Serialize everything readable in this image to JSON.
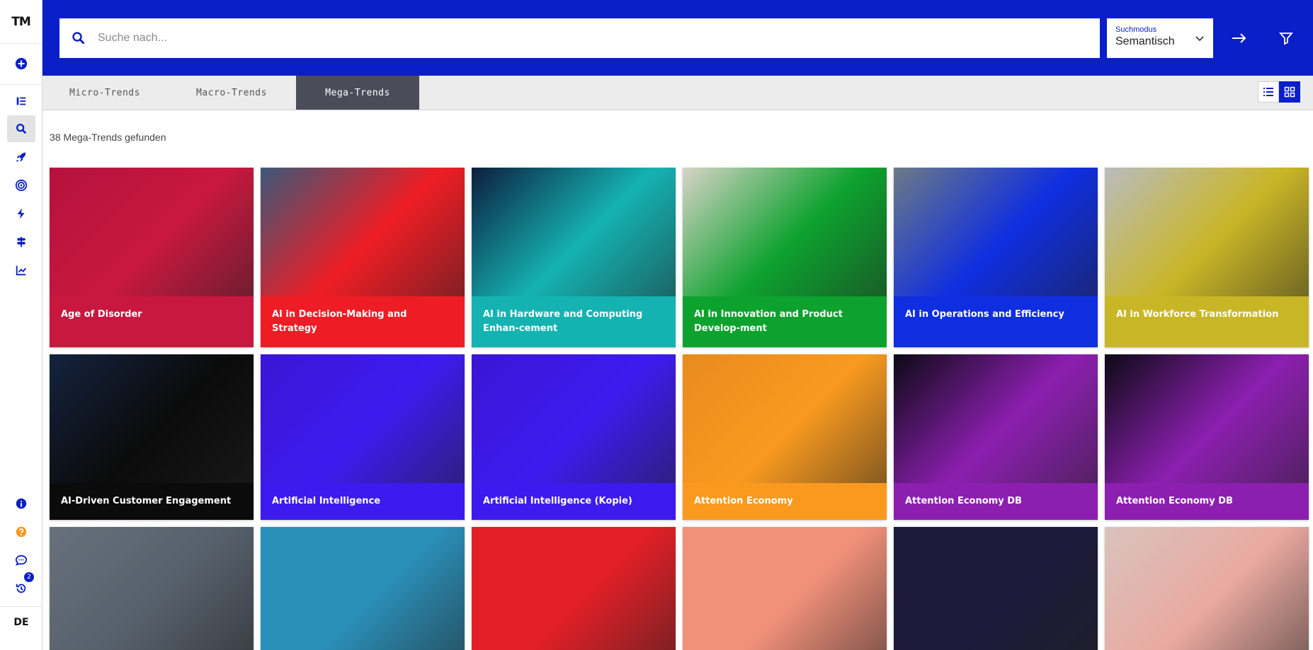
{
  "sidebar": {
    "logo": "TM",
    "language": "DE",
    "history_badge": "2"
  },
  "search": {
    "placeholder": "Suche nach...",
    "value": "",
    "mode_label": "Suchmodus",
    "mode_value": "Semantisch"
  },
  "tabs": [
    {
      "label": "Micro-Trends"
    },
    {
      "label": "Macro-Trends"
    },
    {
      "label": "Mega-Trends"
    }
  ],
  "results": {
    "count_text": "38 Mega-Trends gefunden"
  },
  "cards": [
    {
      "title": "Age of Disorder",
      "color": "#c8183f",
      "art": "#b5123d"
    },
    {
      "title": "AI in Decision-Making and Strategy",
      "color": "#ee1d25",
      "art": "#3b5878"
    },
    {
      "title": "AI in Hardware and Computing Enhan-cement",
      "color": "#15b2b2",
      "art": "#0c1d3e"
    },
    {
      "title": "AI in Innovation and Product Develop-ment",
      "color": "#0da22e",
      "art": "#d9d3c8"
    },
    {
      "title": "AI in Operations and Efficiency",
      "color": "#0f2ee0",
      "art": "#6c7a86"
    },
    {
      "title": "AI in Workforce Transformation",
      "color": "#c9b626",
      "art": "#b9bcbf"
    },
    {
      "title": "AI-Driven Customer Engagement",
      "color": "#0b0b0b",
      "art": "#14233e"
    },
    {
      "title": "Artificial Intelligence",
      "color": "#3d1bef",
      "art": "#3a16d3"
    },
    {
      "title": "Artificial Intelligence (Kopie)",
      "color": "#3d1bef",
      "art": "#3a16d3"
    },
    {
      "title": "Attention Economy",
      "color": "#f99a1f",
      "art": "#e98a1f"
    },
    {
      "title": "Attention Economy DB",
      "color": "#8c1fb0",
      "art": "#0c0a14"
    },
    {
      "title": "Attention Economy DB",
      "color": "#8c1fb0",
      "art": "#0c0a14"
    },
    {
      "title": "",
      "color": "#56606b",
      "art": "#66717c"
    },
    {
      "title": "",
      "color": "#2a8fb8",
      "art": "#2a8fb8"
    },
    {
      "title": "",
      "color": "#e21f26",
      "art": "#e21f26"
    },
    {
      "title": "",
      "color": "#f2917a",
      "art": "#f2917a"
    },
    {
      "title": "",
      "color": "#1c1a3a",
      "art": "#1c1a3a"
    },
    {
      "title": "",
      "color": "#e9a9a0",
      "art": "#d9c3bd"
    }
  ],
  "colors": {
    "brand": "#0a1fc7",
    "tab_active": "#4a4c5a"
  }
}
